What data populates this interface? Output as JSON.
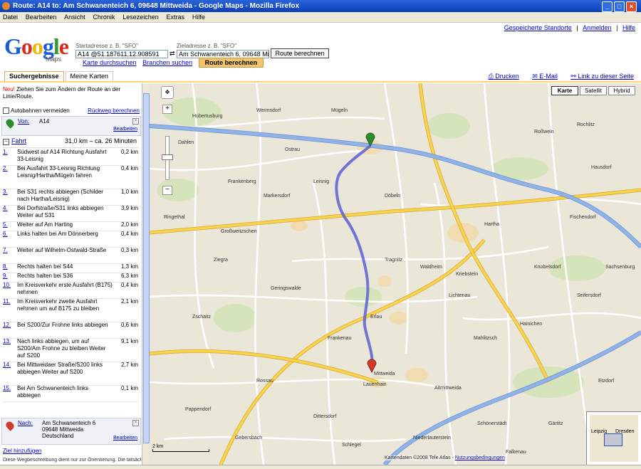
{
  "window": {
    "title": "Route: A14 to: Am Schwanenteich 6, 09648 Mittweida - Google Maps - Mozilla Firefox"
  },
  "menu": [
    "Datei",
    "Bearbeiten",
    "Ansicht",
    "Chronik",
    "Lesezeichen",
    "Extras",
    "Hilfe"
  ],
  "top_links": {
    "saved": "Gespeicherte Standorte",
    "login": "Anmelden",
    "help": "Hilfe"
  },
  "logo": {
    "text": "Google",
    "sub": "Maps"
  },
  "start": {
    "label": "Startadresse z. B. \"SFO\"",
    "value": "A14 @51.187611,12.908591"
  },
  "end": {
    "label": "Zieladresse z. B. \"SFO\"",
    "value": "Am Schwanenteich 6, 09648 Mittweida"
  },
  "route_button": "Route berechnen",
  "links": {
    "search": "Karte durchsuchen",
    "business": "Branchen suchen",
    "route": "Route berechnen"
  },
  "tabs": [
    "Suchergebnisse",
    "Meine Karten"
  ],
  "map_tools": {
    "print": "Drucken",
    "email": "E-Mail",
    "link": "Link zu dieser Seite"
  },
  "panel": {
    "hint_new": "Neu!",
    "hint": "Ziehen Sie zum Ändern der Route an der Linie/Route.",
    "avoid": "Autobahnen vermeiden",
    "reverse": "Rückweg berechnen",
    "from_label": "Von:",
    "from_value": "A14",
    "edit": "Bearbeiten",
    "drive_label": "Fahrt",
    "drive_summary": "31,0 km – ca. 26 Minuten",
    "to_label": "Nach:",
    "to_lines": [
      "Am Schwanenteich 6",
      "09648 Mittweida",
      "Deutschland"
    ],
    "edit2": "Bearbeiten",
    "add_dest": "Ziel hinzufügen",
    "footnote": "Diese Wegbeschreibung dient nur zur Orientierung. Die tatsächlichen Ba"
  },
  "steps": [
    {
      "n": "1.",
      "t": "Südwest auf A14 Richtung Ausfahrt 33-Leisnig",
      "d": "0,2 km"
    },
    {
      "n": "2.",
      "t": "Bei Ausfahrt 33-Leisnig Richtung Leisnig/Hartha/Mügeln fahren",
      "d": "0,4 km"
    },
    {
      "n": "3.",
      "t": "Bei S31 rechts abbiegen (Schilder nach Hartha/Leisnig)",
      "d": "1,0 km"
    },
    {
      "n": "4.",
      "t": "Bei Dorfstraße/S31 links abbiegen Weiter auf S31",
      "d": "3,9 km"
    },
    {
      "n": "5.",
      "t": "Weiter auf Am Harting",
      "d": "2,0 km"
    },
    {
      "n": "6.",
      "t": "Links halten bei Am Dönnerberg",
      "d": "0,4 km"
    },
    {
      "n": "7.",
      "t": "Weiter auf Wilhelm-Ostwald-Straße",
      "d": "0,3 km"
    },
    {
      "n": "8.",
      "t": "Rechts halten bei S44",
      "d": "1,3 km"
    },
    {
      "n": "9.",
      "t": "Rechts halten bei S36",
      "d": "6,3 km"
    },
    {
      "n": "10.",
      "t": "Im Kreisverkehr erste Ausfahrt (B175) nehmen",
      "d": "0,4 km"
    },
    {
      "n": "11.",
      "t": "Im Kreisverkehr zweite Ausfahrt nehmen um auf B175 zu bleiben",
      "d": "2,1 km"
    },
    {
      "n": "12.",
      "t": "Bei S200/Zur Frohne links abbiegen",
      "d": "0,6 km"
    },
    {
      "n": "13.",
      "t": "Nach links abbiegen, um auf S200/Am Frohne zu bleiben Weiter auf S200",
      "d": "9,1 km"
    },
    {
      "n": "14.",
      "t": "Bei Mittweidaer Straße/S200 links abbiegen Weiter auf S200",
      "d": "2,7 km"
    },
    {
      "n": "15.",
      "t": "Bei Am Schwanenteich links abbiegen",
      "d": "0,1 km"
    }
  ],
  "map": {
    "types": [
      "Karte",
      "Satellit",
      "Hybrid"
    ],
    "selected_type": "Karte",
    "copyright": "Kartendaten ©2008 Tele Atlas -",
    "terms": "Nutzungsbedingungen",
    "scale_km": "2 km",
    "overview_labels": [
      "Leipzig",
      "Dresden"
    ],
    "places": [
      "Hubertusburg",
      "Wermsdorf",
      "Dahlen",
      "Mügeln",
      "Leisnig",
      "Hartha",
      "Döbeln",
      "Großweitzschen",
      "Waldheim",
      "Kriebstein",
      "Mittweida",
      "Rochlitz",
      "Geringswalde",
      "Erlau",
      "Frankenau",
      "Lauenhain",
      "Roßwein",
      "Hainichen",
      "Frankenberg",
      "Ostrau",
      "Zschaitz",
      "Altmittweida",
      "Mahlitzsch",
      "Tragnitz",
      "Fischendorf",
      "Ziegra",
      "Knobelsdorf",
      "Seifersdorf",
      "Schönerstädt",
      "Dittersdorf",
      "Rossau",
      "Etzdorf",
      "Gärtitz",
      "Niederlauterstein",
      "Pappendorf",
      "Schlegel",
      "Falkenau",
      "Hausdorf",
      "Sachsenburg",
      "Ringethal",
      "Markersdorf",
      "Lichtenau",
      "Dittmannsdorf",
      "Gebersbach"
    ],
    "colors": {
      "route": "#5a5fd1",
      "autobahn": "#8fb3e8",
      "bstrasse": "#f7d44a",
      "land": "#eae6d8"
    }
  }
}
